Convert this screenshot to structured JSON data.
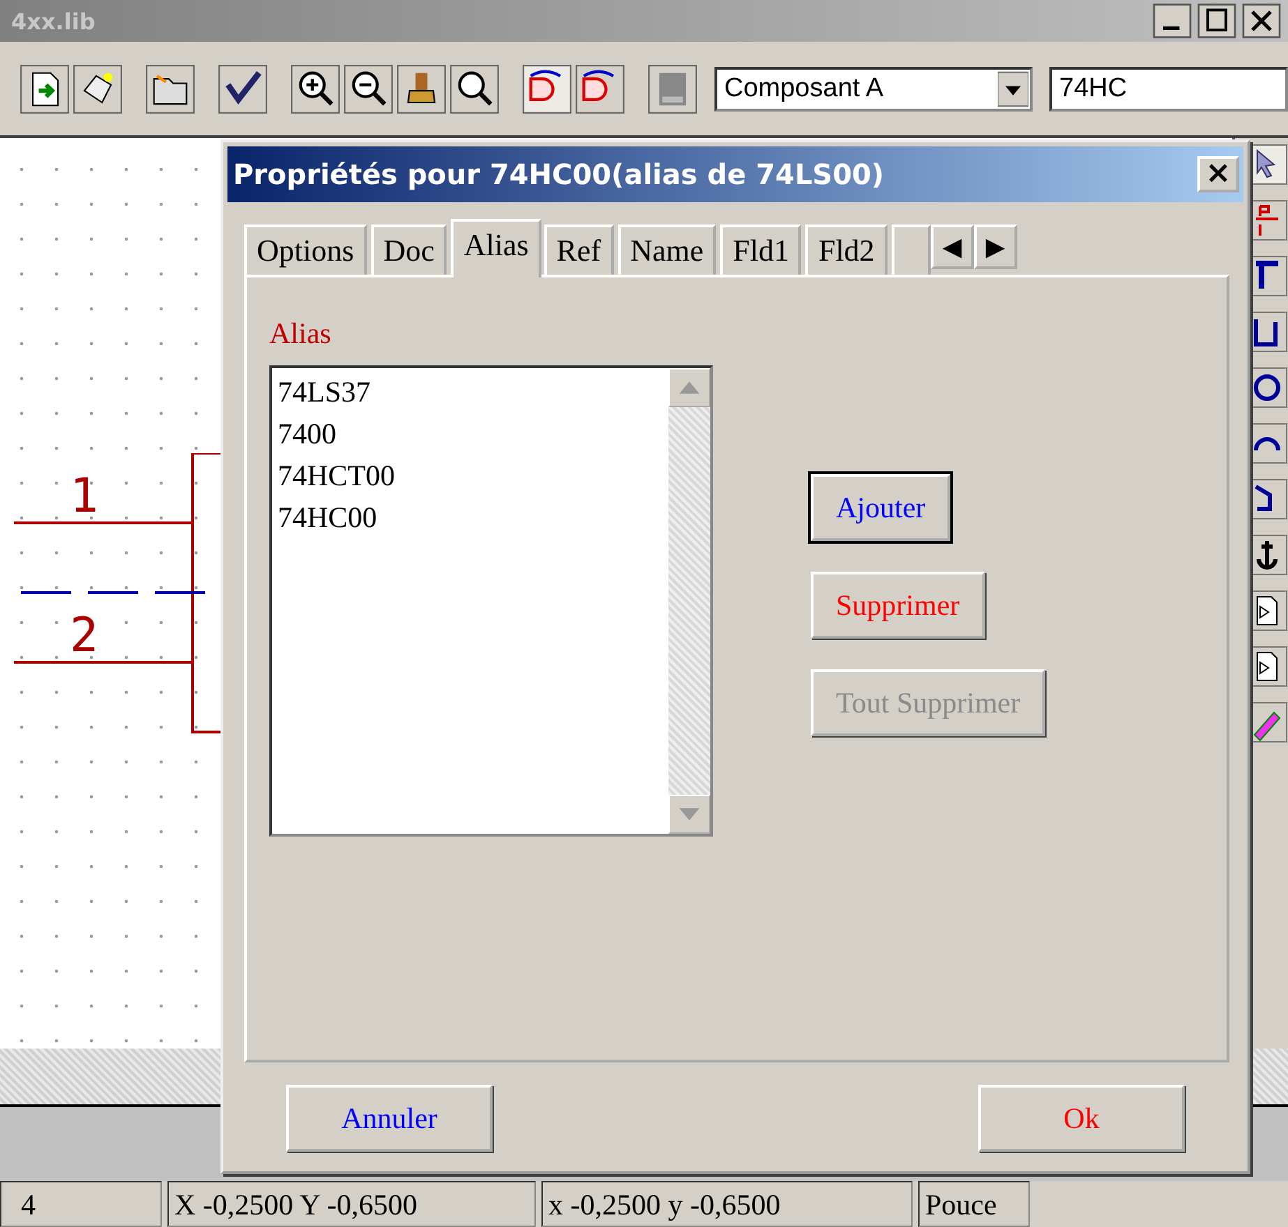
{
  "window": {
    "title": "4xx.lib"
  },
  "toolbar": {
    "tools": [
      {
        "pressed": false
      },
      {
        "pressed": false
      },
      {
        "pressed": false
      },
      {
        "pressed": false
      },
      {
        "pressed": false
      },
      {
        "pressed": false
      },
      {
        "pressed": false
      },
      {
        "pressed": false
      },
      {
        "pressed": true
      },
      {
        "pressed": false
      },
      {
        "pressed": false
      }
    ],
    "unit_select": {
      "value": "Composant A"
    },
    "part_field": {
      "value": "74HC"
    }
  },
  "side_toolbar": {
    "tools": [
      {
        "pressed": true
      },
      {
        "pressed": false
      },
      {
        "pressed": false
      },
      {
        "pressed": false
      },
      {
        "pressed": false
      },
      {
        "pressed": false
      },
      {
        "pressed": false
      },
      {
        "pressed": false
      },
      {
        "pressed": false
      },
      {
        "pressed": false
      },
      {
        "pressed": false
      }
    ]
  },
  "schematic": {
    "pins": [
      "1",
      "2"
    ]
  },
  "status_bar": [
    "4",
    "X -0,2500  Y -0,6500",
    "x -0,2500  y -0,6500",
    "Pouce"
  ],
  "dialog": {
    "title": "Propriétés pour 74HC00(alias de 74LS00)",
    "close": "×",
    "tabs": [
      {
        "label": "Options",
        "selected": false
      },
      {
        "label": "Doc",
        "selected": false
      },
      {
        "label": "Alias",
        "selected": true
      },
      {
        "label": "Ref",
        "selected": false
      },
      {
        "label": "Name",
        "selected": false
      },
      {
        "label": "Fld1",
        "selected": false
      },
      {
        "label": "Fld2",
        "selected": false
      }
    ],
    "tab_scroll": [
      "◀",
      "▶"
    ],
    "alias_label": "Alias",
    "aliases": [
      "74LS37",
      "7400",
      "74HCT00",
      "74HC00"
    ],
    "buttons": [
      {
        "label": "Ajouter",
        "kind": "add",
        "disabled": false
      },
      {
        "label": "Supprimer",
        "kind": "remove",
        "disabled": false
      },
      {
        "label": "Tout Supprimer",
        "kind": "remove",
        "disabled": true
      }
    ],
    "footer": [
      {
        "label": "Annuler",
        "kind": "cancel"
      },
      {
        "label": "Ok",
        "kind": "ok"
      }
    ]
  }
}
